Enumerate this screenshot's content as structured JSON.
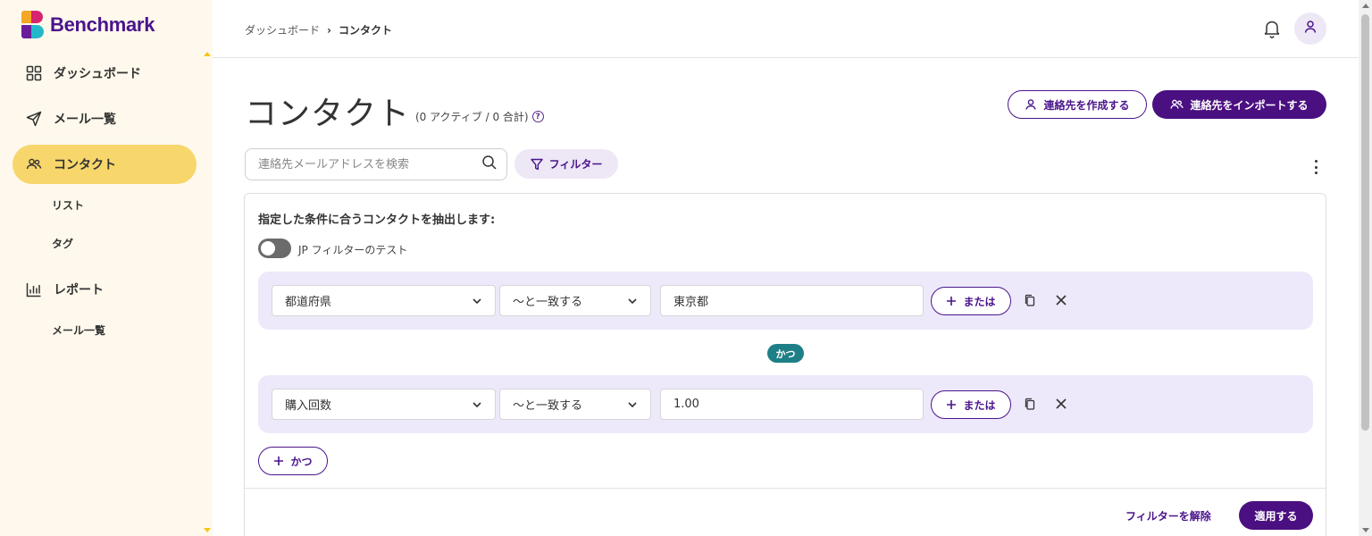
{
  "brand": {
    "name": "Benchmark"
  },
  "sidebar": {
    "items": [
      {
        "label": "ダッシュボード",
        "icon": "grid-icon"
      },
      {
        "label": "メール一覧",
        "icon": "send-icon"
      },
      {
        "label": "コンタクト",
        "icon": "contacts-icon",
        "active": true
      },
      {
        "label": "レポート",
        "icon": "bar-chart-icon"
      }
    ],
    "sub_items": {
      "contacts": [
        "リスト",
        "タグ"
      ],
      "reports": [
        "メール一覧"
      ]
    }
  },
  "header": {
    "breadcrumb": {
      "parent": "ダッシュボード",
      "separator": "›",
      "current": "コンタクト"
    }
  },
  "main": {
    "title": "コンタクト",
    "counts": "(0 アクティブ / 0 合計)",
    "help_glyph": "?",
    "buttons": {
      "create": "連絡先を作成する",
      "import": "連絡先をインポートする"
    },
    "search": {
      "placeholder": "連絡先メールアドレスを検索",
      "value": ""
    },
    "filter_chip": "フィルター"
  },
  "filter_panel": {
    "heading": "指定した条件に合うコンタクトを抽出します:",
    "toggle_label": "JP フィルターのテスト",
    "toggle_on": false,
    "conditions": [
      {
        "field": "都道府県",
        "operator": "〜と一致する",
        "value": "東京都",
        "or_label": "または"
      },
      {
        "field": "購入回数",
        "operator": "〜と一致する",
        "value": "1.00",
        "or_label": "または"
      }
    ],
    "and_badge": "かつ",
    "and_button": "かつ",
    "clear": "フィルターを解除",
    "apply": "適用する"
  },
  "colors": {
    "brand_purple": "#4a0f80",
    "sidebar_bg": "#fef9ec",
    "active_nav": "#f7d66c",
    "condition_bg": "#ede9fb",
    "and_badge": "#1e7f86"
  }
}
